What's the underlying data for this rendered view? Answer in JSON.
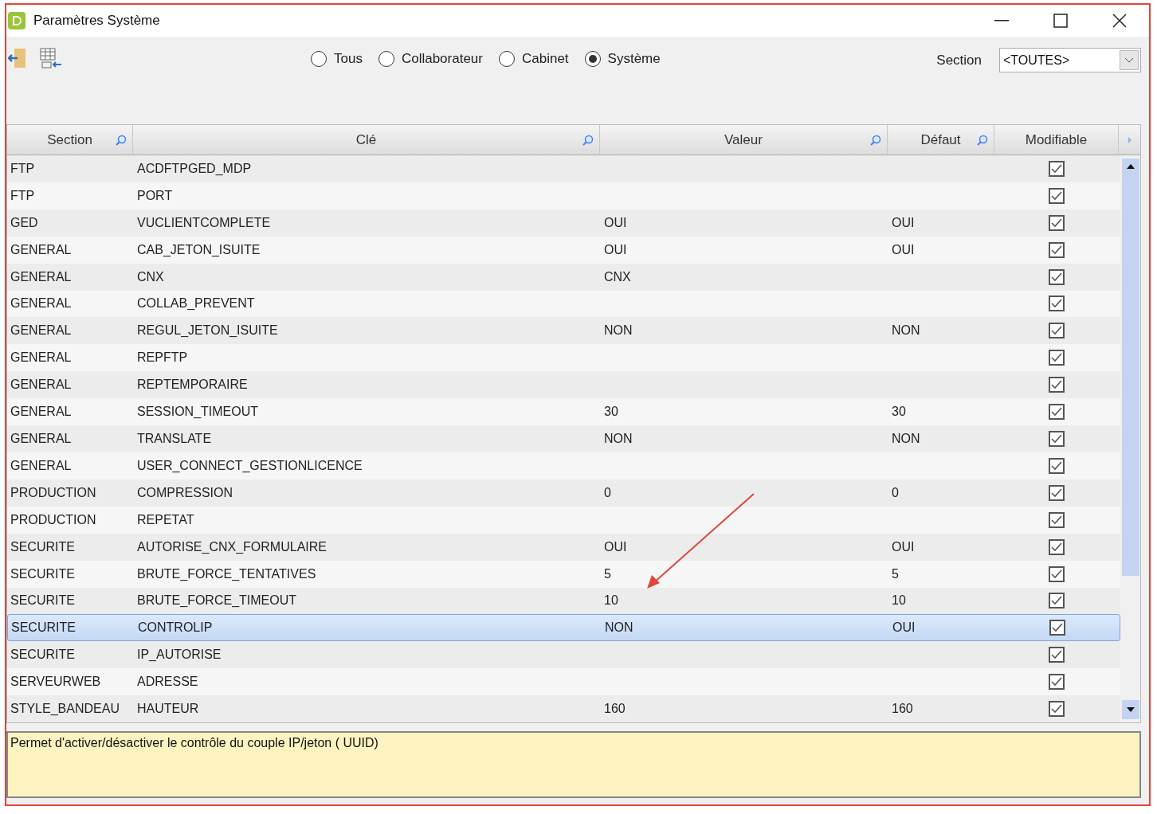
{
  "window": {
    "title": "Paramètres Système"
  },
  "filters": [
    {
      "label": "Tous",
      "selected": false
    },
    {
      "label": "Collaborateur",
      "selected": false
    },
    {
      "label": "Cabinet",
      "selected": false
    },
    {
      "label": "Système",
      "selected": true
    }
  ],
  "section_filter": {
    "label": "Section",
    "value": "<TOUTES>"
  },
  "table": {
    "columns": [
      {
        "label": "Section",
        "searchable": true
      },
      {
        "label": "Clé",
        "searchable": true
      },
      {
        "label": "Valeur",
        "searchable": true
      },
      {
        "label": "Défaut",
        "searchable": true
      },
      {
        "label": "Modifiable",
        "searchable": false
      }
    ],
    "rows": [
      {
        "section": "FTP",
        "key": "ACDFTPGED_MDP",
        "value": "",
        "default": "",
        "modifiable": true,
        "selected": false
      },
      {
        "section": "FTP",
        "key": "PORT",
        "value": "",
        "default": "",
        "modifiable": true,
        "selected": false
      },
      {
        "section": "GED",
        "key": "VUCLIENTCOMPLETE",
        "value": "OUI",
        "default": "OUI",
        "modifiable": true,
        "selected": false
      },
      {
        "section": "GENERAL",
        "key": "CAB_JETON_ISUITE",
        "value": "OUI",
        "default": "OUI",
        "modifiable": true,
        "selected": false
      },
      {
        "section": "GENERAL",
        "key": "CNX",
        "value": "CNX",
        "default": "",
        "modifiable": true,
        "selected": false
      },
      {
        "section": "GENERAL",
        "key": "COLLAB_PREVENT",
        "value": "",
        "default": "",
        "modifiable": true,
        "selected": false
      },
      {
        "section": "GENERAL",
        "key": "REGUL_JETON_ISUITE",
        "value": "NON",
        "default": "NON",
        "modifiable": true,
        "selected": false
      },
      {
        "section": "GENERAL",
        "key": "REPFTP",
        "value": "",
        "default": "",
        "modifiable": true,
        "selected": false
      },
      {
        "section": "GENERAL",
        "key": "REPTEMPORAIRE",
        "value": "",
        "default": "",
        "modifiable": true,
        "selected": false
      },
      {
        "section": "GENERAL",
        "key": "SESSION_TIMEOUT",
        "value": "30",
        "default": "30",
        "modifiable": true,
        "selected": false
      },
      {
        "section": "GENERAL",
        "key": "TRANSLATE",
        "value": "NON",
        "default": "NON",
        "modifiable": true,
        "selected": false
      },
      {
        "section": "GENERAL",
        "key": "USER_CONNECT_GESTIONLICENCE",
        "value": "",
        "default": "",
        "modifiable": true,
        "selected": false
      },
      {
        "section": "PRODUCTION",
        "key": "COMPRESSION",
        "value": "0",
        "default": "0",
        "modifiable": true,
        "selected": false
      },
      {
        "section": "PRODUCTION",
        "key": "REPETAT",
        "value": "",
        "default": "",
        "modifiable": true,
        "selected": false
      },
      {
        "section": "SECURITE",
        "key": "AUTORISE_CNX_FORMULAIRE",
        "value": "OUI",
        "default": "OUI",
        "modifiable": true,
        "selected": false
      },
      {
        "section": "SECURITE",
        "key": "BRUTE_FORCE_TENTATIVES",
        "value": "5",
        "default": "5",
        "modifiable": true,
        "selected": false
      },
      {
        "section": "SECURITE",
        "key": "BRUTE_FORCE_TIMEOUT",
        "value": "10",
        "default": "10",
        "modifiable": true,
        "selected": false
      },
      {
        "section": "SECURITE",
        "key": "CONTROLIP",
        "value": "NON",
        "default": "OUI",
        "modifiable": true,
        "selected": true
      },
      {
        "section": "SECURITE",
        "key": "IP_AUTORISE",
        "value": "",
        "default": "",
        "modifiable": true,
        "selected": false
      },
      {
        "section": "SERVEURWEB",
        "key": "ADRESSE",
        "value": "",
        "default": "",
        "modifiable": true,
        "selected": false
      },
      {
        "section": "STYLE_BANDEAU",
        "key": "HAUTEUR",
        "value": "160",
        "default": "160",
        "modifiable": true,
        "selected": false
      }
    ]
  },
  "description": "Permet d'activer/désactiver le contrôle du couple IP/jeton ( UUID)"
}
